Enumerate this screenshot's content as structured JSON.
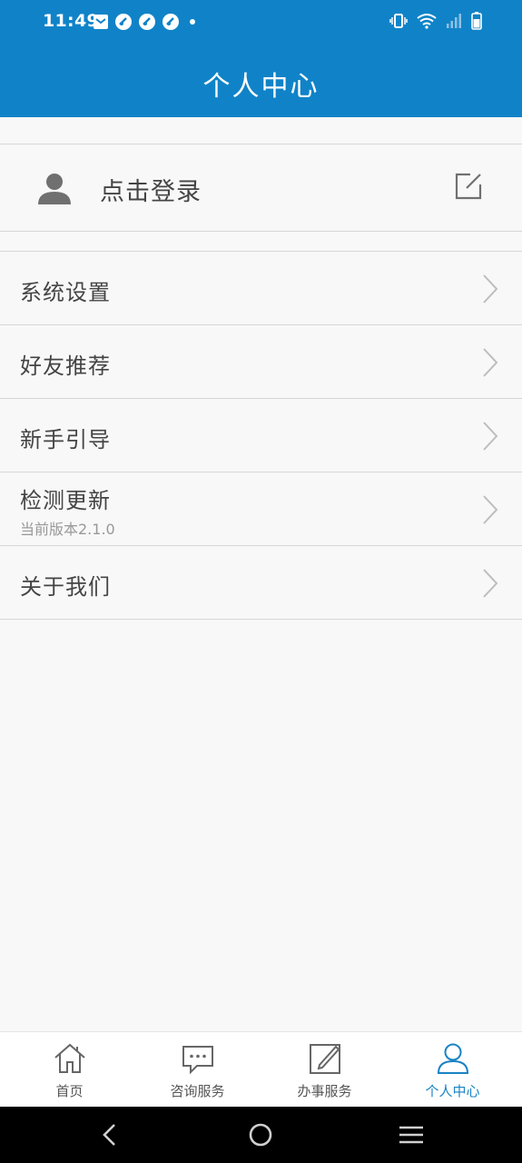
{
  "status_bar": {
    "time": "11:49",
    "left_icons": [
      "mail-icon",
      "app-icon",
      "app-icon",
      "app-icon",
      "dot-icon"
    ],
    "right_icons": [
      "vibrate-icon",
      "wifi-icon",
      "signal-icon",
      "battery-icon"
    ]
  },
  "header": {
    "title": "个人中心",
    "color": "#1083c8"
  },
  "user": {
    "login_label": "点击登录"
  },
  "menu": [
    {
      "label": "系统设置"
    },
    {
      "label": "好友推荐"
    },
    {
      "label": "新手引导"
    },
    {
      "label": "检测更新",
      "sub": "当前版本2.1.0"
    },
    {
      "label": "关于我们"
    }
  ],
  "tabs": [
    {
      "label": "首页",
      "icon": "home-icon"
    },
    {
      "label": "咨询服务",
      "icon": "chat-icon"
    },
    {
      "label": "办事服务",
      "icon": "edit-icon"
    },
    {
      "label": "个人中心",
      "icon": "person-icon",
      "active": true
    }
  ],
  "accent": "#1a82c4"
}
